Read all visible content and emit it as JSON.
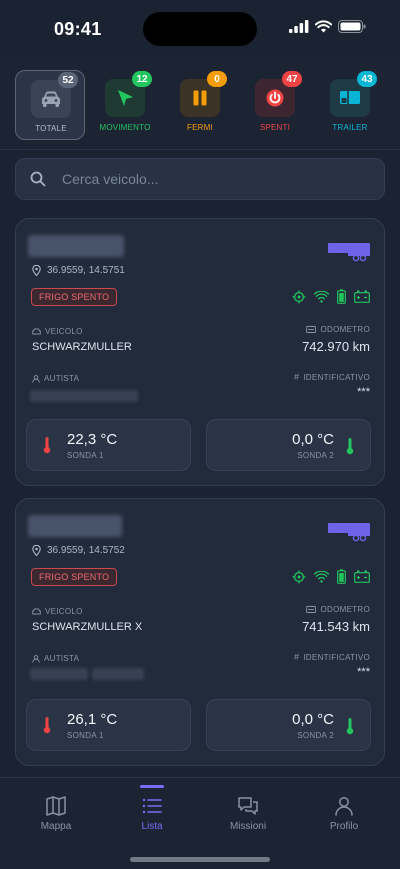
{
  "status_bar": {
    "time": "09:41"
  },
  "filters": [
    {
      "label": "TOTALE",
      "count": "52",
      "color": "#9aa3b2",
      "badge_color": "#5b6578",
      "icon": "car-icon"
    },
    {
      "label": "MOVIMENTO",
      "count": "12",
      "color": "#22c55e",
      "badge_color": "#22c55e",
      "icon": "navigation-arrow-icon"
    },
    {
      "label": "FERMI",
      "count": "0",
      "color": "#f59e0b",
      "badge_color": "#f59e0b",
      "icon": "pause-icon"
    },
    {
      "label": "SPENTI",
      "count": "47",
      "color": "#ef4444",
      "badge_color": "#ef4444",
      "icon": "power-icon"
    },
    {
      "label": "TRAILER",
      "count": "43",
      "color": "#06b6d4",
      "badge_color": "#06b6d4",
      "icon": "trailer-icon"
    }
  ],
  "search": {
    "placeholder": "Cerca veicolo..."
  },
  "vehicles": [
    {
      "coords": "36.9559, 14.5751",
      "status": "FRIGO SPENTO",
      "vehicle_label": "VEICOLO",
      "vehicle": "SCHWARZMULLER",
      "odometer_label": "ODOMETRO",
      "odometer": "742.970 km",
      "driver_label": "AUTISTA",
      "id_label": "IDENTIFICATIVO",
      "identifier": "***",
      "probe1_value": "22,3 °C",
      "probe1_label": "SONDA 1",
      "probe2_value": "0,0 °C",
      "probe2_label": "SONDA 2"
    },
    {
      "coords": "36.9559, 14.5752",
      "status": "FRIGO SPENTO",
      "vehicle_label": "VEICOLO",
      "vehicle": "SCHWARZMULLER X",
      "odometer_label": "ODOMETRO",
      "odometer": "741.543 km",
      "driver_label": "AUTISTA",
      "id_label": "IDENTIFICATIVO",
      "identifier": "***",
      "probe1_value": "26,1 °C",
      "probe1_label": "SONDA 1",
      "probe2_value": "0,0 °C",
      "probe2_label": "SONDA 2"
    }
  ],
  "nav": [
    {
      "label": "Mappa",
      "icon": "map-icon",
      "active": false
    },
    {
      "label": "Lista",
      "icon": "list-icon",
      "active": true
    },
    {
      "label": "Missioni",
      "icon": "chat-icon",
      "active": false
    },
    {
      "label": "Profilo",
      "icon": "user-icon",
      "active": false
    }
  ],
  "colors": {
    "accent": "#7b6cf6",
    "danger": "#ef6a6e",
    "sensor_green": "#22c55e",
    "probe_cold": "#22c55e",
    "probe_warm": "#ef4444"
  }
}
